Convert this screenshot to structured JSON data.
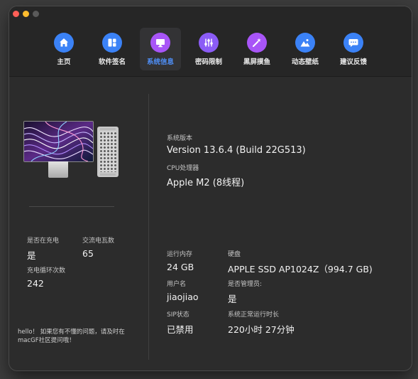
{
  "tabs": [
    {
      "label": "主页",
      "icon": "home-icon",
      "color": "#3b82f6"
    },
    {
      "label": "软件签名",
      "icon": "app-grid-icon",
      "color": "#3b82f6"
    },
    {
      "label": "系统信息",
      "icon": "monitor-icon",
      "color": "#a855f7"
    },
    {
      "label": "密码限制",
      "icon": "sliders-icon",
      "color": "#8b5cf6"
    },
    {
      "label": "黑屏摸鱼",
      "icon": "magic-wand-icon",
      "color": "#a855f7"
    },
    {
      "label": "动态壁纸",
      "icon": "mountain-image-icon",
      "color": "#3b82f6"
    },
    {
      "label": "建议反馈",
      "icon": "chat-bubble-icon",
      "color": "#3b82f6"
    }
  ],
  "active_tab": 2,
  "accent": "#4f8ff7",
  "battery": {
    "charging_label": "是否在充电",
    "charging_value": "是",
    "wattage_label": "交流电瓦数",
    "wattage_value": "65",
    "cycles_label": "充电循环次数",
    "cycles_value": "242"
  },
  "tip": "hello！ 如果您有不懂的问题，请及时在macGF社区提问哦！",
  "system": {
    "version_label": "系统版本",
    "version_value": "Version 13.6.4 (Build 22G513)",
    "cpu_label": "CPU处理器",
    "cpu_value": "Apple M2 (8线程)",
    "ram_label": "运行内存",
    "ram_value": "24 GB",
    "disk_label": "硬盘",
    "disk_value": "APPLE SSD AP1024Z（994.7 GB)",
    "user_label": "用户名",
    "user_value": "jiaojiao",
    "admin_label": "是否管理员:",
    "admin_value": "是",
    "sip_label": "SIP状态",
    "sip_value": "已禁用",
    "uptime_label": "系统正常运行时长",
    "uptime_value": "220小时 27分钟"
  }
}
